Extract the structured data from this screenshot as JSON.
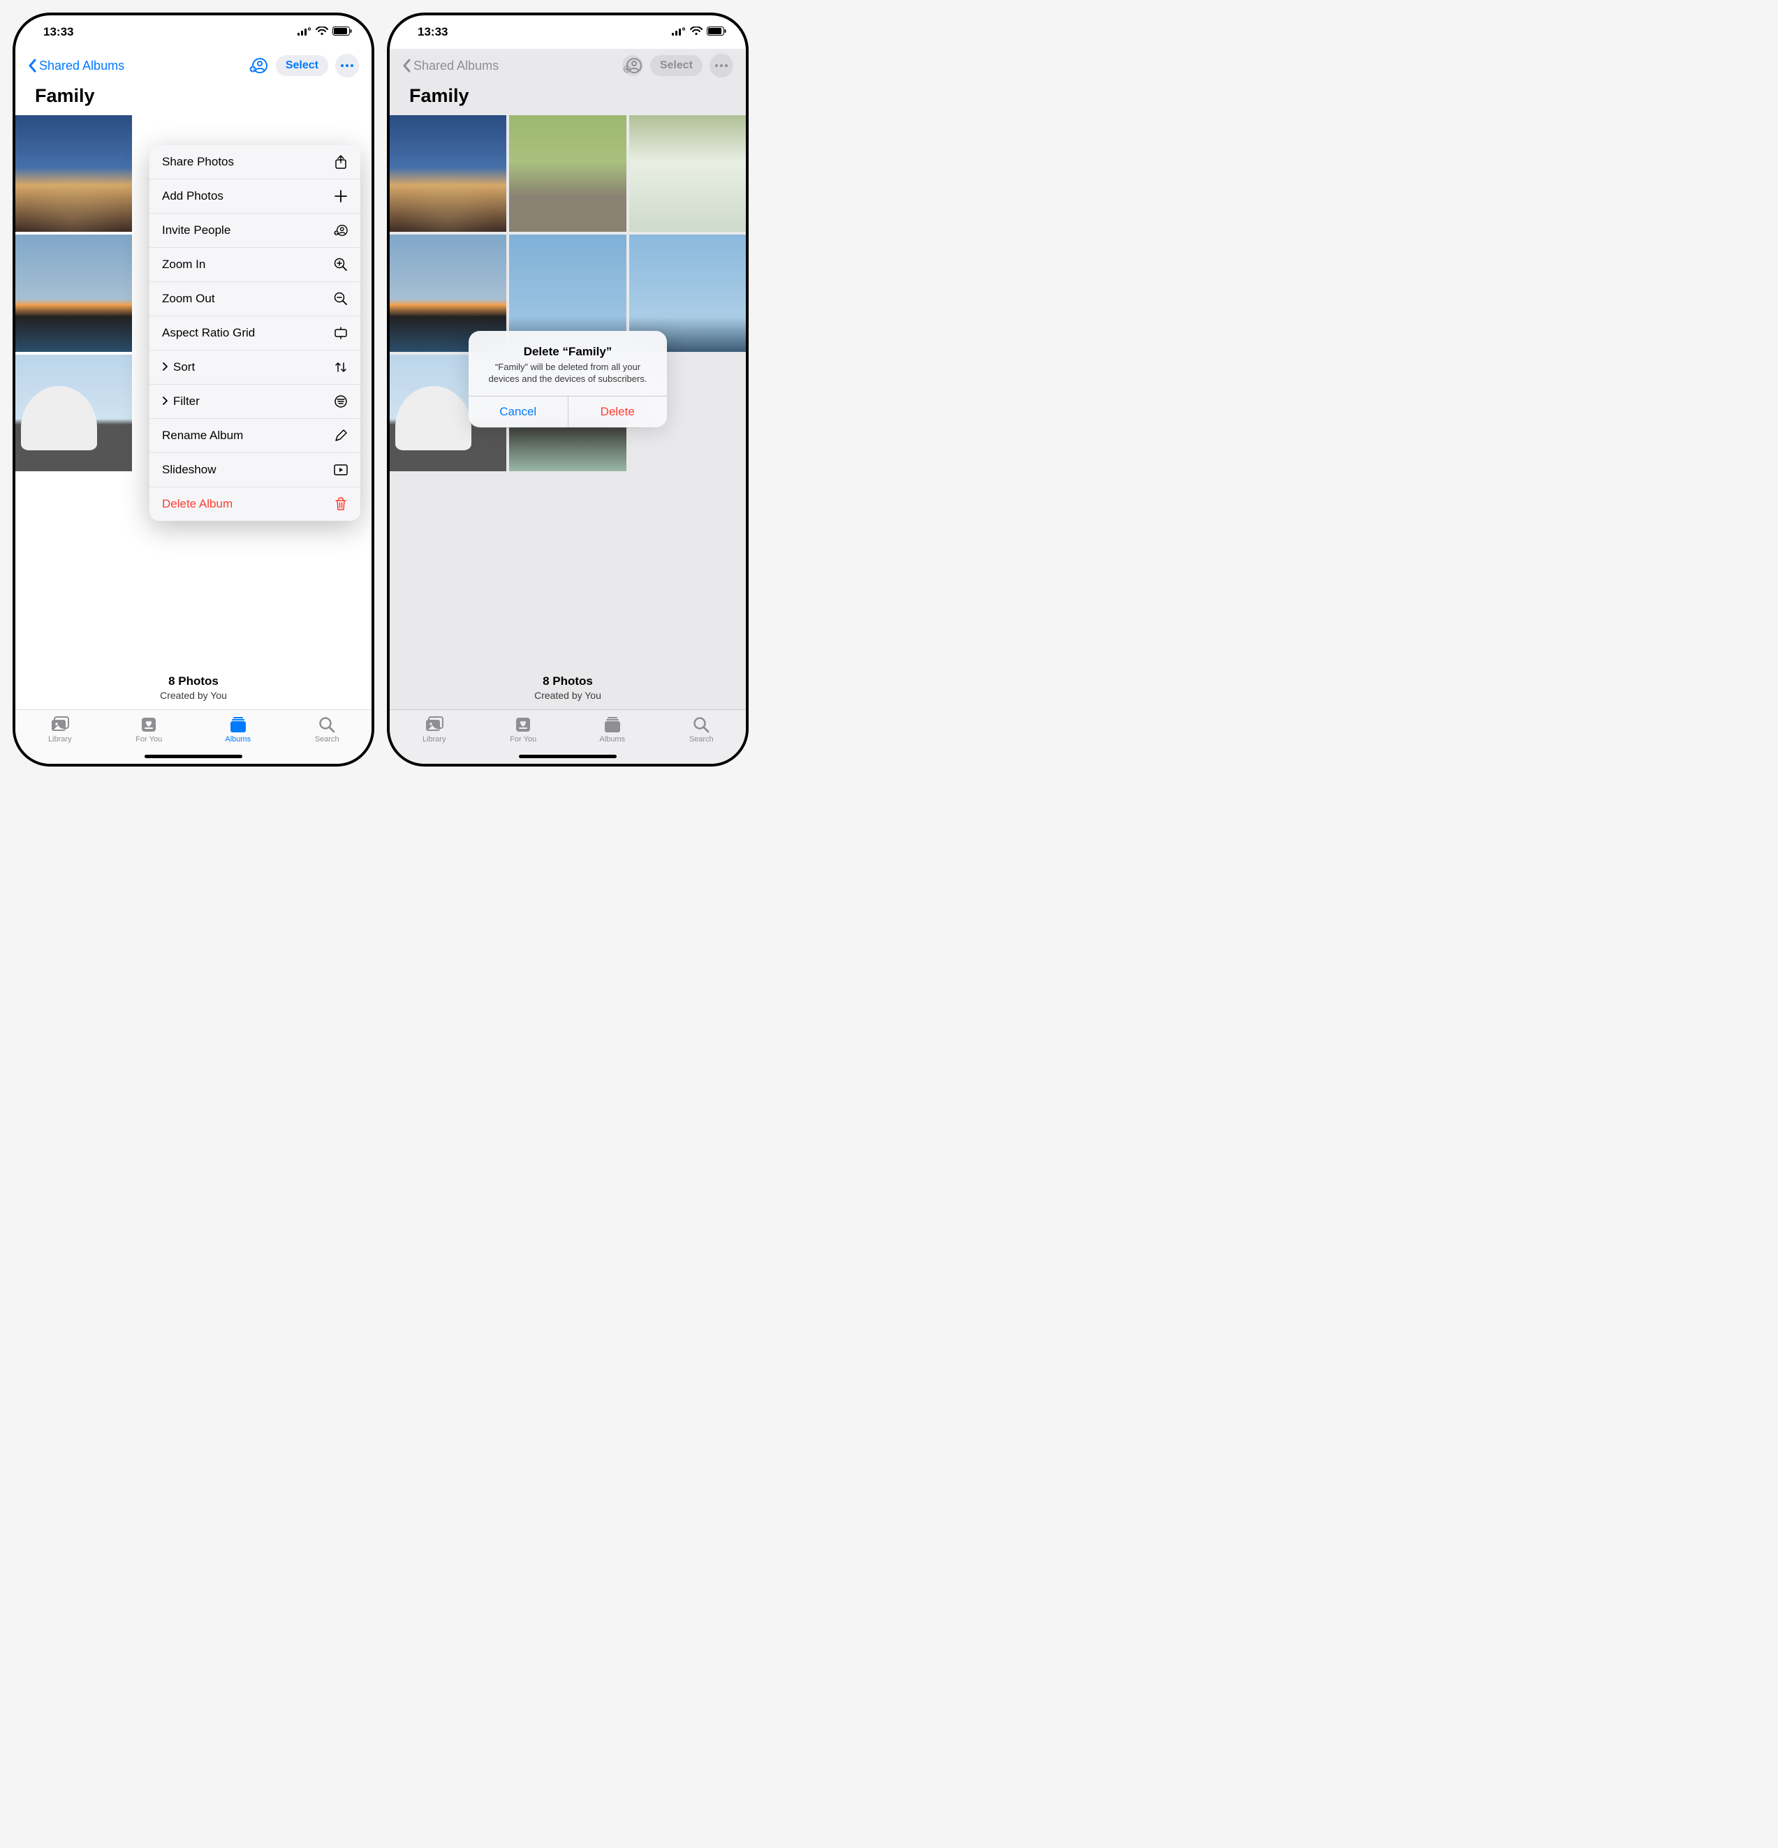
{
  "status": {
    "time": "13:33"
  },
  "nav": {
    "back_label": "Shared Albums",
    "select_label": "Select"
  },
  "album": {
    "title": "Family"
  },
  "footer": {
    "count": "8 Photos",
    "created_by": "Created by You"
  },
  "tabs": {
    "library": "Library",
    "foryou": "For You",
    "albums": "Albums",
    "search": "Search"
  },
  "menu": {
    "share_photos": "Share Photos",
    "add_photos": "Add Photos",
    "invite_people": "Invite People",
    "zoom_in": "Zoom In",
    "zoom_out": "Zoom Out",
    "aspect_ratio": "Aspect Ratio Grid",
    "sort": "Sort",
    "filter": "Filter",
    "rename": "Rename Album",
    "slideshow": "Slideshow",
    "delete": "Delete Album"
  },
  "alert": {
    "title": "Delete “Family”",
    "message": "“Family” will be deleted from all your devices and the devices of subscribers.",
    "cancel": "Cancel",
    "delete": "Delete"
  }
}
